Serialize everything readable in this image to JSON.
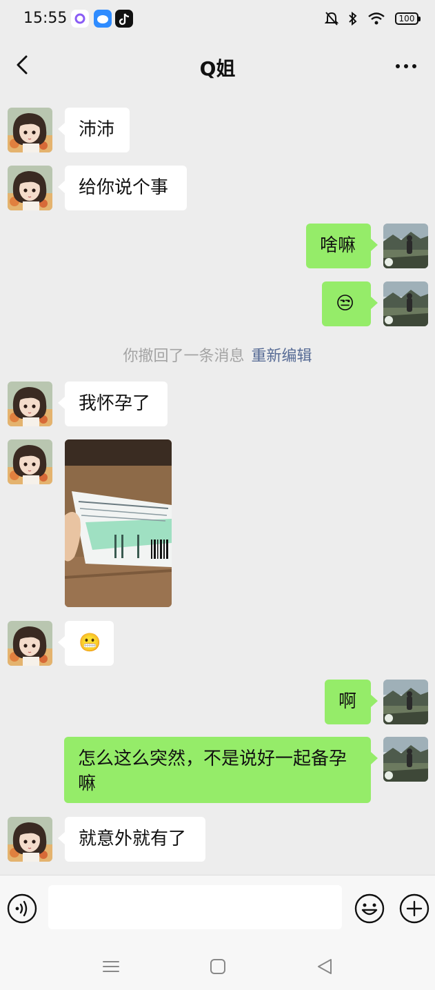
{
  "status_bar": {
    "time": "15:55",
    "battery": "100",
    "icons": [
      "app-icon-purple",
      "app-icon-blue",
      "tiktok-icon",
      "mute-bell-icon",
      "bluetooth-icon",
      "wifi-icon",
      "battery-icon"
    ]
  },
  "nav": {
    "title": "Q姐",
    "back_icon": "chevron-left-icon",
    "more_icon": "more-dots-icon"
  },
  "messages": [
    {
      "side": "in",
      "type": "text",
      "text": "沛沛"
    },
    {
      "side": "in",
      "type": "text",
      "text": "给你说个事"
    },
    {
      "side": "out",
      "type": "text",
      "text": "啥嘛"
    },
    {
      "side": "out",
      "type": "emoji",
      "emoji": "😒"
    },
    {
      "side": "system",
      "type": "recall",
      "text": "你撤回了一条消息",
      "action": "重新编辑"
    },
    {
      "side": "in",
      "type": "text",
      "text": "我怀孕了"
    },
    {
      "side": "in",
      "type": "image",
      "image": "pregnancy-test-photo"
    },
    {
      "side": "in",
      "type": "emoji",
      "emoji": "😬"
    },
    {
      "side": "out",
      "type": "text",
      "text": "啊"
    },
    {
      "side": "out",
      "type": "text",
      "text_line1": "怎么这么突然，不是说好一起备孕",
      "text_line2": "嘛"
    },
    {
      "side": "in",
      "type": "text",
      "text": "就意外就有了"
    }
  ],
  "input_bar": {
    "voice_icon": "voice-icon",
    "placeholder": "",
    "emoji_icon": "emoji-face-icon",
    "plus_icon": "plus-icon"
  },
  "system_nav": {
    "icons": [
      "menu-icon",
      "home-square-icon",
      "back-triangle-icon"
    ]
  },
  "colors": {
    "background": "#ededed",
    "incoming_bubble": "#ffffff",
    "outgoing_bubble": "#95ec69",
    "link": "#576b95",
    "system_text": "#a3a3a3"
  }
}
